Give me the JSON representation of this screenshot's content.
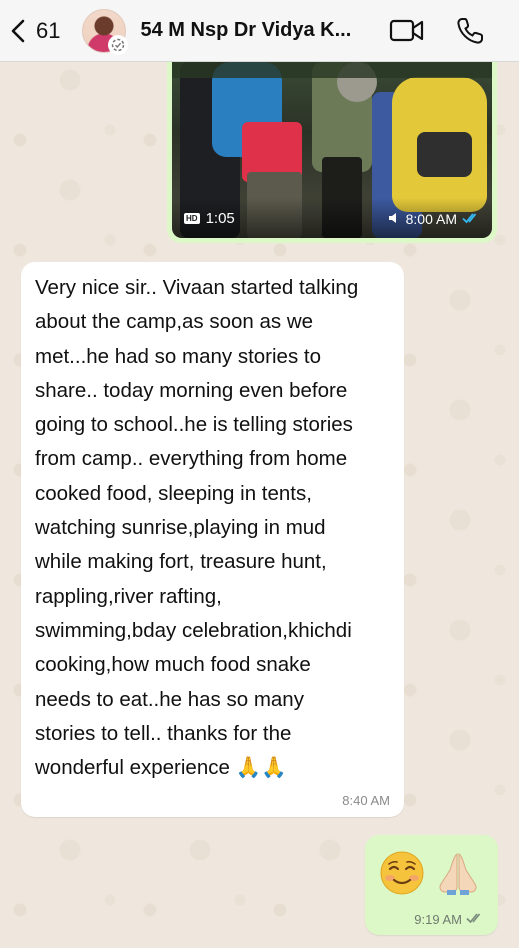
{
  "header": {
    "back_count": "61",
    "contact_name": "54 M Nsp Dr Vidya K...",
    "icons": [
      "chevron-left-icon",
      "avatar",
      "video-call-icon",
      "phone-icon"
    ]
  },
  "messages": {
    "image_message": {
      "hd_label": "HD",
      "duration": "1:05",
      "time": "8:00 AM",
      "status": "read"
    },
    "incoming_text": {
      "text": "Very nice sir.. Vivaan started talking\nabout the camp,as soon as we\nmet...he had so many stories to\nshare.. today morning even before\ngoing to school..he is telling stories\nfrom camp.. everything from home\ncooked food, sleeping in tents,\nwatching sunrise,playing in mud\nwhile making fort, treasure hunt,\nrappling,river rafting,\nswimming,bday celebration,khichdi\ncooking,how much food snake\nneeds to eat..he has so many\nstories to tell.. thanks for the\nwonderful experience 🙏🙏",
      "time": "8:40 AM"
    },
    "outgoing_emoji": {
      "emojis": [
        "smiling-face-icon",
        "folded-hands-icon"
      ],
      "time": "9:19 AM",
      "status": "delivered"
    }
  },
  "colors": {
    "outgoing_bubble": "#dcf8c6",
    "incoming_bubble": "#ffffff",
    "read_ticks": "#34b7f1",
    "wallpaper": "#efe7dd"
  }
}
